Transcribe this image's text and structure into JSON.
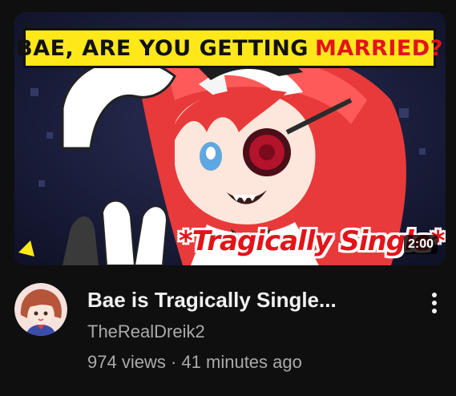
{
  "video": {
    "thumbnail": {
      "banner_text": "BAE, ARE YOU GETTING",
      "banner_accent": "MARRIED?",
      "overlay_caption": "*Tragically Single*",
      "duration": "2:00"
    },
    "title": "Bae is Tragically Single...",
    "channel": "TheRealDreik2",
    "views": "974 views",
    "separator": "·",
    "age": "41 minutes ago",
    "menu_icon": "more-vert-icon"
  },
  "colors": {
    "background": "#0f0f0f",
    "title": "#f1f1f1",
    "secondary_text": "#aaaaaa",
    "banner_yellow": "#ffe81a",
    "banner_red": "#e2141a"
  }
}
